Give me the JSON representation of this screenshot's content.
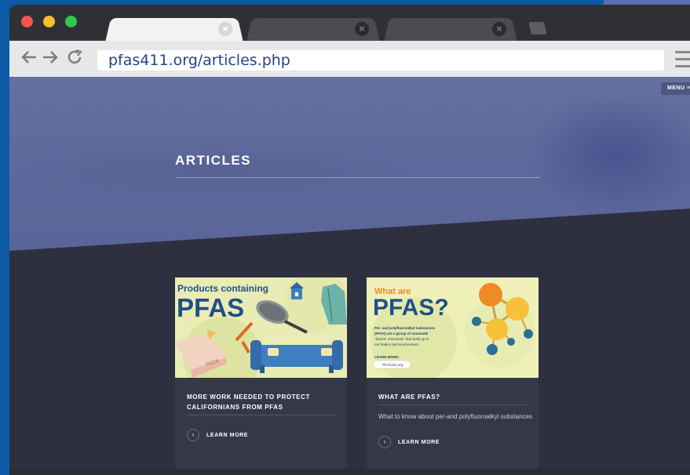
{
  "browser": {
    "tabs": [
      {
        "label": "",
        "state": "active"
      },
      {
        "label": "",
        "state": "inactive"
      },
      {
        "label": "",
        "state": "inactive"
      }
    ],
    "nav": {
      "back_icon": "arrow-left",
      "forward_icon": "arrow-right",
      "reload_icon": "reload"
    },
    "url": "pfas411.org/articles.php"
  },
  "page": {
    "menu_label": "MENU ≡",
    "hero_title": "ARTICLES",
    "cards": [
      {
        "image": {
          "heading_small": "Products containing",
          "heading_big": "PFAS"
        },
        "title": "MORE WORK NEEDED TO PROTECT CALIFORNIANS FROM PFAS",
        "description": "",
        "cta": "LEARN MORE"
      },
      {
        "image": {
          "heading_small": "What are",
          "heading_big": "PFAS?",
          "body_line1": "Per- and polyfluoroalkyl substances",
          "body_line2": "(PFAS) are a group of manmade",
          "body_line3": "\"forever chemicals\" that build up in",
          "body_line4": "our bodies and environment.",
          "learn_more": "LEARN MORE:",
          "site": "PFAS411.org"
        },
        "title": "WHAT ARE PFAS?",
        "description": "What to know about per-and polyfluoroalkyl substances",
        "cta": "LEARN MORE"
      }
    ]
  },
  "colors": {
    "hero": "#5d699c",
    "page_bg": "#2e3040",
    "card_bg": "#353847",
    "url_text": "#2c3f86",
    "pfas_blue": "#1f4f8a",
    "pfas_orange": "#f08a24"
  }
}
